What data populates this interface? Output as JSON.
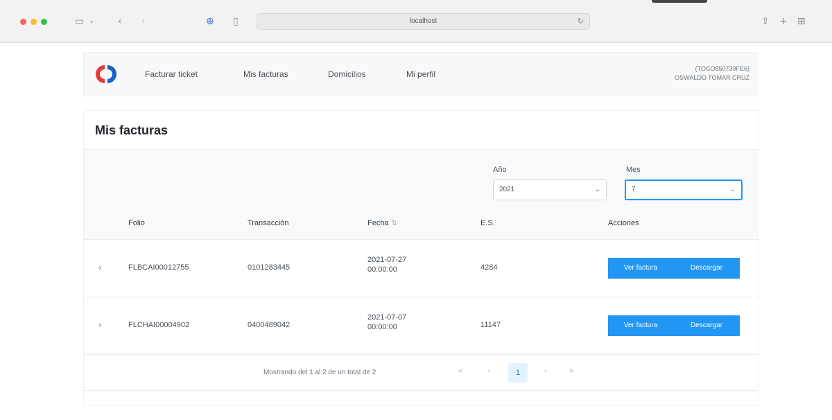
{
  "browser": {
    "url": "localhost"
  },
  "nav": {
    "items": [
      "Facturar ticket",
      "Mis facturas",
      "Domicilios",
      "Mi perfil"
    ],
    "user_id": "(TOCO850739FE6)",
    "user_name": "OSWALDO TOMAR CRUZ"
  },
  "page": {
    "title": "Mis facturas"
  },
  "filters": {
    "year_label": "Año",
    "year_value": "2021",
    "month_label": "Mes",
    "month_value": "7"
  },
  "table": {
    "columns": [
      "Folio",
      "Transacción",
      "Fecha",
      "E.S.",
      "Acciones"
    ],
    "rows": [
      {
        "folio": "FLBCAI00012755",
        "transaccion": "0101283445",
        "fecha_date": "2021-07-27",
        "fecha_time": "00:00:00",
        "es": "4284"
      },
      {
        "folio": "FLCHAI00004902",
        "transaccion": "0400489042",
        "fecha_date": "2021-07-07",
        "fecha_time": "00:00:00",
        "es": "11147"
      }
    ],
    "actions": {
      "view_label": "Ver factura",
      "download_label": "Descargar"
    }
  },
  "paginator": {
    "info": "Mostrando del 1 al 2 de un total de 2",
    "current_page": "1"
  },
  "colors": {
    "primary": "#2196f3",
    "brand_red": "#e53935",
    "brand_blue": "#1565c0"
  }
}
